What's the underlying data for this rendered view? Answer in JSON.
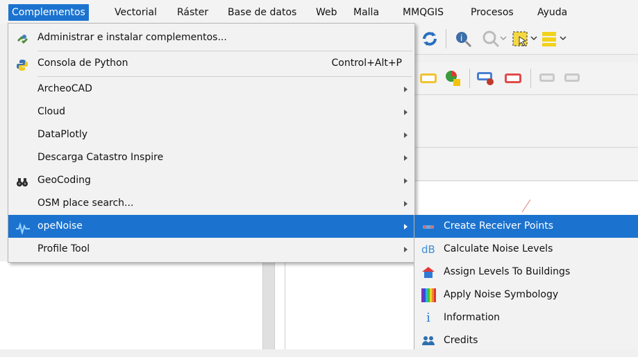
{
  "menubar": {
    "items": [
      {
        "label": "Complementos",
        "active": true
      },
      {
        "label": "Vectorial"
      },
      {
        "label": "Ráster"
      },
      {
        "label": "Base de datos"
      },
      {
        "label": "Web"
      },
      {
        "label": "Malla"
      },
      {
        "label": "MMQGIS"
      },
      {
        "label": "Procesos"
      },
      {
        "label": "Ayuda"
      }
    ]
  },
  "menu": {
    "items": [
      {
        "label": "Administrar e instalar complementos...",
        "icon": "plugin-manager-icon"
      },
      {
        "label": "Consola de Python",
        "shortcut": "Control+Alt+P",
        "icon": "python-icon"
      },
      {
        "label": "ArcheoCAD",
        "submenu": true
      },
      {
        "label": "Cloud",
        "submenu": true
      },
      {
        "label": "DataPlotly",
        "submenu": true
      },
      {
        "label": "Descarga Catastro Inspire",
        "submenu": true
      },
      {
        "label": "GeoCoding",
        "submenu": true,
        "icon": "binoculars-icon"
      },
      {
        "label": "OSM place search...",
        "submenu": true
      },
      {
        "label": "opeNoise",
        "submenu": true,
        "icon": "noise-wave-icon",
        "selected": true
      },
      {
        "label": "Profile Tool",
        "submenu": true
      }
    ]
  },
  "submenu": {
    "items": [
      {
        "label": "Create Receiver Points",
        "icon": "receiver-points-icon",
        "selected": true
      },
      {
        "label": "Calculate Noise Levels",
        "icon": "db-icon",
        "icon_text": "dB"
      },
      {
        "label": "Assign Levels To Buildings",
        "icon": "building-icon"
      },
      {
        "label": "Apply Noise Symbology",
        "icon": "color-bars-icon"
      },
      {
        "label": "Information",
        "icon": "info-icon",
        "icon_text": "i"
      },
      {
        "label": "Credits",
        "icon": "people-icon"
      }
    ]
  },
  "colors": {
    "selection": "#1c73cf",
    "menu_bg": "#f2f2f2",
    "menubar_bg": "#f3f3f3"
  }
}
